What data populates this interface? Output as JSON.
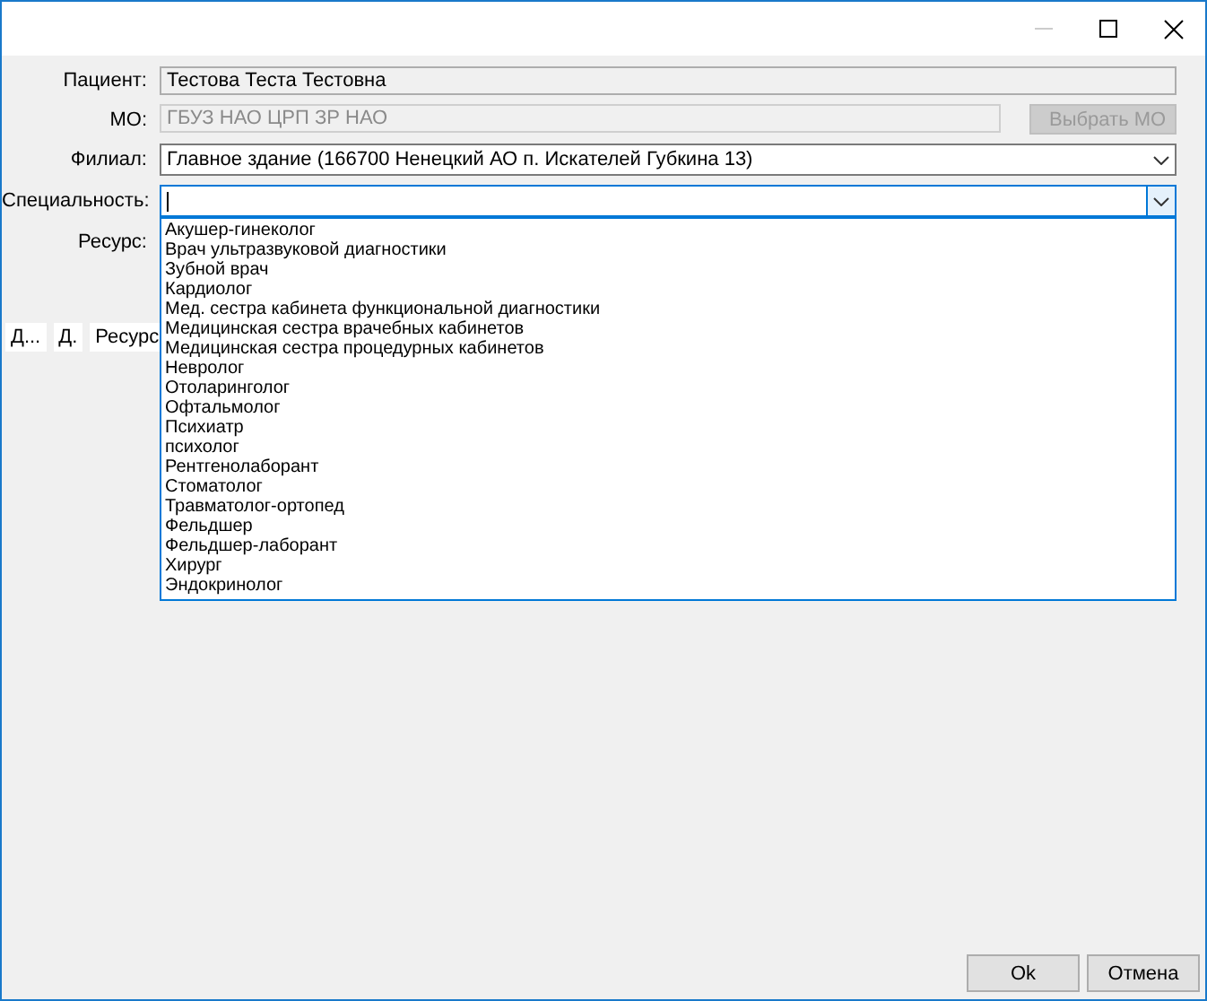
{
  "window": {
    "minimize_disabled": true
  },
  "fields": [
    {
      "kind": "text",
      "label": "Пациент:",
      "value": "Тестова Теста Тестовна",
      "disabled": false
    },
    {
      "kind": "text",
      "label": "МО:",
      "value": "ГБУЗ НАО ЦРП ЗР НАО",
      "disabled": true,
      "button": {
        "label": "Выбрать МО",
        "disabled": true
      }
    },
    {
      "kind": "combo",
      "label": "Филиал:",
      "value": "Главное здание (166700 Ненецкий АО п. Искателей Губкина 13)",
      "expanded": false
    },
    {
      "kind": "combo",
      "label": "Специальность:",
      "expanded": true,
      "options": [
        "Акушер-гинеколог",
        "Врач ультразвуковой диагностики",
        "Зубной врач",
        "Кардиолог",
        "Мед. сестра кабинета функциональной диагностики",
        "Медицинская сестра врачебных кабинетов",
        "Медицинская сестра процедурных кабинетов",
        "Невролог",
        "Отоларинголог",
        "Офтальмолог",
        "Психиатр",
        "психолог",
        "Рентгенолаборант",
        "Стоматолог",
        "Травматолог-ортопед",
        "Фельдшер",
        "Фельдшер-лаборант",
        "Хирург",
        "Эндокринолог"
      ]
    },
    {
      "kind": "label",
      "label": "Ресурс:"
    }
  ],
  "table": {
    "columns": [
      "Д...",
      "Д.",
      "Ресурс"
    ]
  },
  "buttons": [
    "Ok",
    "Отмена"
  ]
}
